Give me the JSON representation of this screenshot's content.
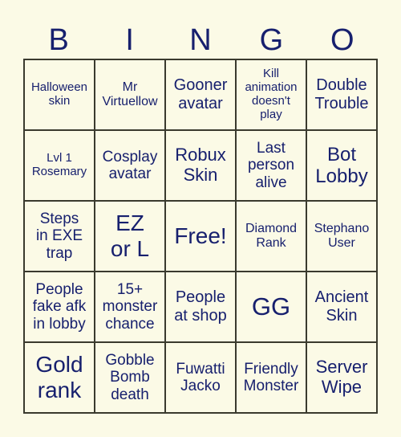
{
  "header": {
    "letters": [
      "B",
      "I",
      "N",
      "G",
      "O"
    ]
  },
  "colors": {
    "background": "#fbfae6",
    "text": "#17206e",
    "border": "#3a3a2e"
  },
  "board": {
    "rows": [
      [
        "Halloween\nskin",
        "Mr\nVirtuellow",
        "Gooner\navatar",
        "Kill\nanimation\ndoesn't\nplay",
        "Double\nTrouble"
      ],
      [
        "Lvl 1\nRosemary",
        "Cosplay\navatar",
        "Robux\nSkin",
        "Last\nperson\nalive",
        "Bot\nLobby"
      ],
      [
        "Steps\nin EXE\ntrap",
        "EZ\nor L",
        "Free!",
        "Diamond\nRank",
        "Stephano\nUser"
      ],
      [
        "People\nfake afk\nin lobby",
        "15+\nmonster\nchance",
        "People\nat shop",
        "GG",
        "Ancient\nSkin"
      ],
      [
        "Gold\nrank",
        "Gobble\nBomb\ndeath",
        "Fuwatti\nJacko",
        "Friendly\nMonster",
        "Server\nWipe"
      ]
    ],
    "free_space": "Free!"
  }
}
